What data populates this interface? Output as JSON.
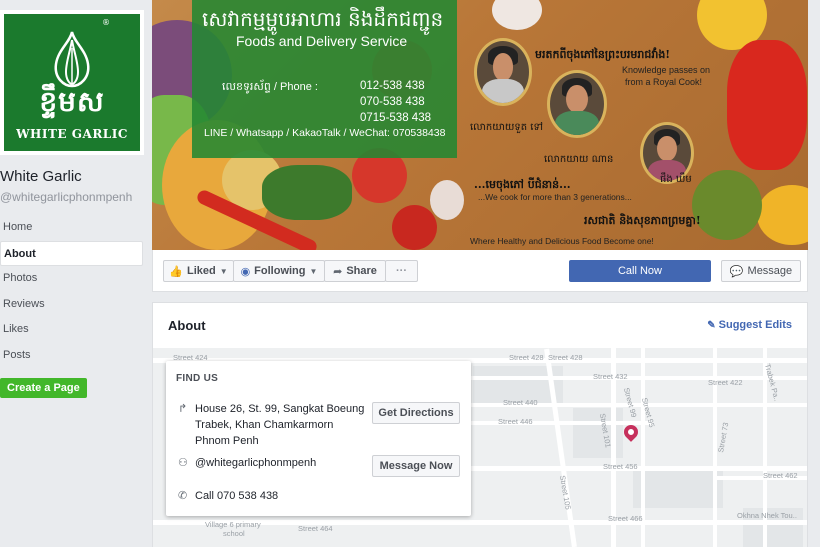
{
  "page": {
    "name": "White Garlic",
    "handle": "@whitegarlicphonmpenh",
    "logo_khmer": "ខ្ទឹមស",
    "logo_en": "WHITE GARLIC",
    "logo_mark": "®"
  },
  "left_nav": {
    "items": [
      {
        "label": "Home"
      },
      {
        "label": "About"
      },
      {
        "label": "Photos"
      },
      {
        "label": "Reviews"
      },
      {
        "label": "Likes"
      },
      {
        "label": "Posts"
      }
    ],
    "active": "About",
    "create_page": "Create a Page"
  },
  "cover": {
    "khmer_title": "សេវាកម្មម្ហូបអាហារ និងដឹកជញ្ជូន",
    "title": "Foods and Delivery Service",
    "phone_label": "លេខទូរស័ព្ទ / Phone :",
    "phones": [
      "012-538 438",
      "070-538 438",
      "0715-538 438"
    ],
    "messengers": "LINE / Whatsapp / KakaoTalk / WeChat: 070538438",
    "khmer_heading": "មរតកពីចុងភៅនៃព្រះបរមរាជវាំង!",
    "knowledge": "Knowledge passes on",
    "royal_cook": "from a Royal Cook!",
    "khmer_sub": "...មេចុងភៅ បីជំនាន់...",
    "generations": "...We cook for more than 3 generations...",
    "khmer_slogan": "រសជាតិ និងសុខភាពព្រមគ្នា!",
    "slogan": "Where Healthy and Delicious Food Become one!",
    "captions": [
      "លោកយាយទួត ទៅ",
      "លោកយាយ ណាន",
      "ផឹង ឃឹម"
    ]
  },
  "actions": {
    "liked": "Liked",
    "following": "Following",
    "share": "Share",
    "more": "···",
    "call_now": "Call Now",
    "message": "Message"
  },
  "about": {
    "title": "About",
    "suggest_edits": "Suggest Edits",
    "find_us": "FIND US",
    "address_line1": "House 26, St. 99, Sangkat Boeung",
    "address_line2": "Trabek, Khan Chamkarmorn",
    "address_line3": "Phnom Penh",
    "get_directions": "Get Directions",
    "messenger_handle": "@whitegarlicphonmpenh",
    "message_now": "Message Now",
    "call": "Call 070 538 438"
  },
  "map_labels": {
    "street_424": "Street 424",
    "street_428a": "Street 428",
    "street_428b": "Street 428",
    "street_432": "Street 432",
    "street_440": "Street 440",
    "street_446": "Street 446",
    "street_456": "Street 456",
    "street_462": "Street 462",
    "street_464": "Street 464",
    "street_466": "Street 466",
    "street_422": "Street 422",
    "street_99": "Street 99",
    "street_95": "Street 95",
    "street_101": "Street 101",
    "street_105": "Street 105",
    "street_73": "Street 73",
    "trabek": "Trabek Pa..",
    "okhna": "Okhna Nhek Tou..",
    "village": "Village 6 primary",
    "school": "school"
  },
  "colors": {
    "brand_blue": "#4267b2",
    "green": "#42b72a",
    "logo_green": "#1b7a2d",
    "pin": "#c6305c"
  }
}
